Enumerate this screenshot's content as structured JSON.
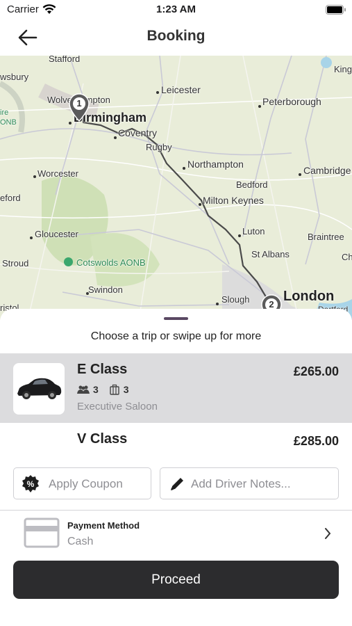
{
  "status_bar": {
    "carrier": "Carrier",
    "time": "1:23 AM"
  },
  "header": {
    "title": "Booking"
  },
  "map": {
    "labels": {
      "stafford": "Stafford",
      "wolverhampton": "Wolverhampton",
      "birmingham": "Birmingham",
      "leicester": "Leicester",
      "peterborough": "Peterborough",
      "kings_lynn": "King",
      "coventry": "Coventry",
      "rugby": "Rugby",
      "worcester": "Worcester",
      "northampton": "Northampton",
      "cambridge": "Cambridge",
      "bedford": "Bedford",
      "milton_keynes": "Milton Keynes",
      "hereford": "eford",
      "gloucester": "Gloucester",
      "luton": "Luton",
      "braintree": "Braintree",
      "stroud": "Stroud",
      "cotswolds": "Cotswolds AONB",
      "st_albans": "St Albans",
      "swindon": "Swindon",
      "slough": "Slough",
      "london": "London",
      "bristol": "ristol",
      "dartford": "Dartford",
      "shrewsbury": "wsbury",
      "aonb_left": "ire\nONB",
      "ch": "Ch"
    },
    "markers": {
      "start": "1",
      "end": "2"
    }
  },
  "sheet": {
    "hint": "Choose a trip or swipe up for more",
    "trips": [
      {
        "name": "E Class",
        "price": "£265.00",
        "passengers": "3",
        "luggage": "3",
        "description": "Executive Saloon"
      },
      {
        "name": "V Class",
        "price": "£285.00"
      }
    ],
    "coupon_label": "Apply Coupon",
    "notes_label": "Add Driver Notes...",
    "payment": {
      "label": "Payment Method",
      "value": "Cash"
    },
    "proceed_label": "Proceed"
  },
  "colors": {
    "accent": "#5a4863",
    "button": "#2c2c2e",
    "selected_row": "#dcdcde",
    "route": "#4a4a4a"
  }
}
